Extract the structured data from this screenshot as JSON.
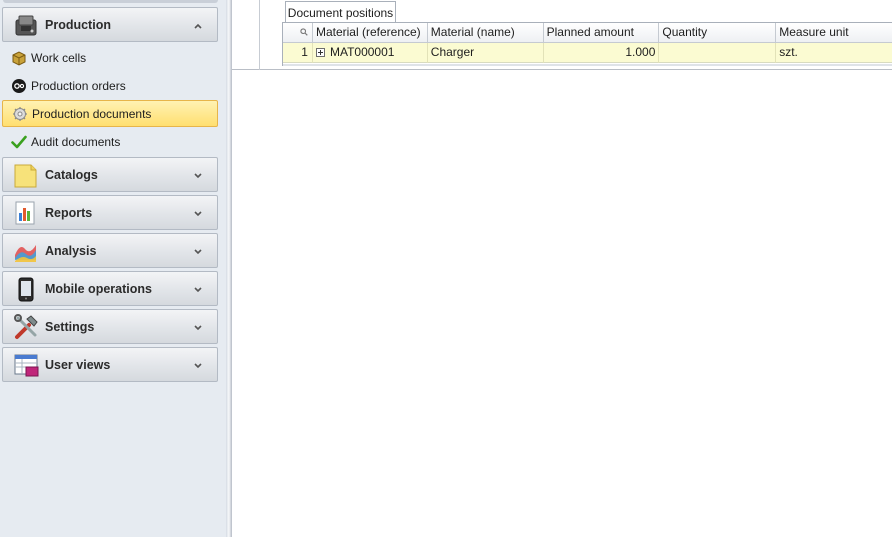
{
  "sidebar": {
    "groups": [
      {
        "label": "Production",
        "icon": "production-icon",
        "expanded": true
      },
      {
        "label": "Catalogs",
        "icon": "catalogs-icon",
        "expanded": false
      },
      {
        "label": "Reports",
        "icon": "reports-icon",
        "expanded": false
      },
      {
        "label": "Analysis",
        "icon": "analysis-icon",
        "expanded": false
      },
      {
        "label": "Mobile operations",
        "icon": "mobile-icon",
        "expanded": false
      },
      {
        "label": "Settings",
        "icon": "settings-icon",
        "expanded": false
      },
      {
        "label": "User views",
        "icon": "user-views-icon",
        "expanded": false
      }
    ],
    "production_items": [
      {
        "label": "Work cells",
        "icon": "work-cells-icon"
      },
      {
        "label": "Production orders",
        "icon": "production-orders-icon"
      },
      {
        "label": "Production documents",
        "icon": "production-documents-icon",
        "selected": true
      },
      {
        "label": "Audit documents",
        "icon": "checkmark-icon"
      }
    ]
  },
  "main": {
    "tab_label": "Document positions",
    "grid": {
      "columns": [
        "Material (reference)",
        "Material (name)",
        "Planned amount",
        "Quantity",
        "Measure unit"
      ],
      "rows": [
        {
          "index": "1",
          "material_ref": "MAT000001",
          "material_name": "Charger",
          "planned_amount": "1.000",
          "quantity": "",
          "measure_unit": "szt."
        }
      ]
    }
  },
  "colors": {
    "selection": "#ffdf70",
    "row_highlight": "#fbfbd2",
    "sidebar_bg": "#e6ebf1"
  }
}
